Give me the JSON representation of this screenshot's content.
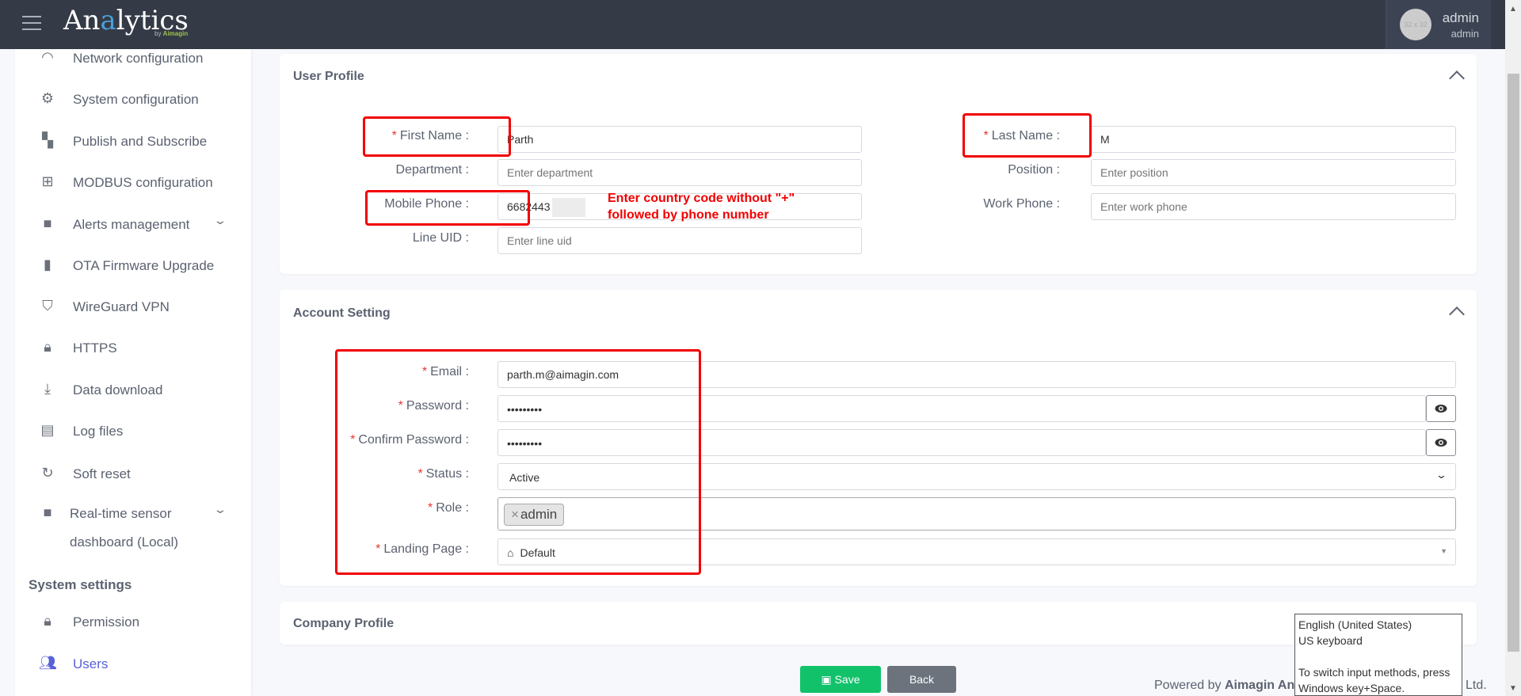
{
  "header": {
    "app_title_prefix": "An",
    "app_title_accent": "a",
    "app_title_suffix": "lytics",
    "app_subtitle_prefix": "by ",
    "app_subtitle_brand": "Aimagin",
    "avatar_placeholder": "32 x 32",
    "user_name": "admin",
    "user_role": "admin"
  },
  "sidebar": {
    "items": [
      {
        "label": "Network configuration",
        "icon": "wifi-icon"
      },
      {
        "label": "System configuration",
        "icon": "gear-icon"
      },
      {
        "label": "Publish and Subscribe",
        "icon": "sitemap-icon"
      },
      {
        "label": "MODBUS configuration",
        "icon": "network-icon"
      },
      {
        "label": "Alerts management",
        "icon": "folder-icon",
        "expandable": true
      },
      {
        "label": "OTA Firmware Upgrade",
        "icon": "chip-icon"
      },
      {
        "label": "WireGuard VPN",
        "icon": "shield-icon"
      },
      {
        "label": "HTTPS",
        "icon": "lock-icon"
      },
      {
        "label": "Data download",
        "icon": "download-icon"
      },
      {
        "label": "Log files",
        "icon": "file-icon"
      },
      {
        "label": "Soft reset",
        "icon": "redo-icon"
      },
      {
        "label_line1": "Real-time sensor",
        "label_line2": "dashboard (Local)",
        "icon": "folder-icon",
        "expandable": true
      }
    ],
    "section_title": "System settings",
    "settings_items": [
      {
        "label": "Permission",
        "icon": "lock-icon"
      },
      {
        "label": "Users",
        "icon": "users-icon",
        "active": true
      }
    ]
  },
  "user_profile": {
    "title": "User Profile",
    "first_name": {
      "label": "First Name :",
      "value": "Parth"
    },
    "department": {
      "label": "Department :",
      "placeholder": "Enter department"
    },
    "mobile_phone": {
      "label": "Mobile Phone :",
      "value": "6682443"
    },
    "line_uid": {
      "label": "Line UID :",
      "placeholder": "Enter line uid"
    },
    "last_name": {
      "label": "Last Name :",
      "value": "M"
    },
    "position": {
      "label": "Position :",
      "placeholder": "Enter position"
    },
    "work_phone": {
      "label": "Work Phone :",
      "placeholder": "Enter work phone"
    },
    "annotation_line1": "Enter country code without \"+\"",
    "annotation_line2": "followed by phone number"
  },
  "account_setting": {
    "title": "Account Setting",
    "email": {
      "label": "Email :",
      "value": "parth.m@aimagin.com"
    },
    "password": {
      "label": "Password :",
      "value": "•••••••••"
    },
    "confirm_password": {
      "label": "Confirm Password :",
      "value": "•••••••••"
    },
    "status": {
      "label": "Status :",
      "value": "Active"
    },
    "role": {
      "label": "Role :",
      "tags": [
        "admin"
      ]
    },
    "landing_page": {
      "label": "Landing Page :",
      "value": "Default"
    }
  },
  "company_profile": {
    "title": "Company Profile"
  },
  "actions": {
    "save": "Save",
    "back": "Back"
  },
  "footer": {
    "prefix": "Powered by ",
    "brand": "Aimagin An",
    "suffix": "Ltd."
  },
  "ime_tooltip": {
    "line1": "English (United States)",
    "line2": "US keyboard",
    "line3": "To switch input methods, press",
    "line4": "Windows key+Space."
  },
  "colors": {
    "header": "#343a46",
    "accent": "#5a62d8",
    "save": "#12c26b",
    "back": "#6c737d",
    "annotation": "#f20000"
  }
}
